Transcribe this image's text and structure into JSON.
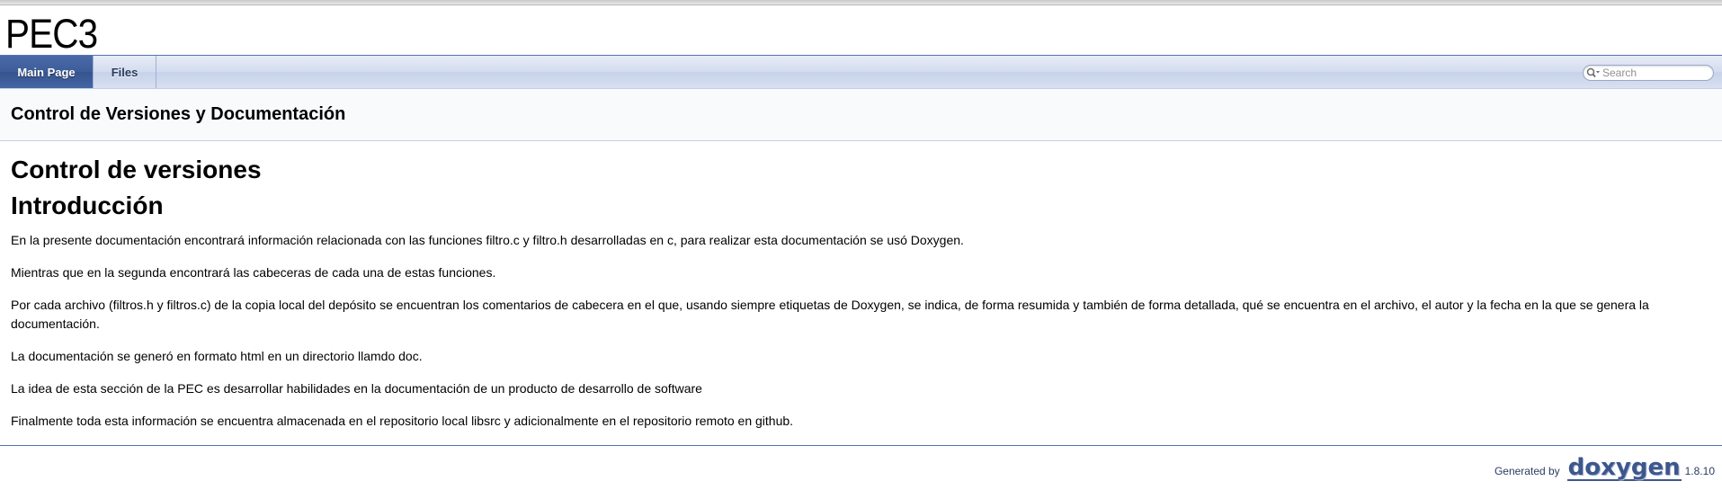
{
  "project": {
    "name": "PEC3"
  },
  "nav": {
    "tabs": [
      {
        "label": "Main Page",
        "active": true
      },
      {
        "label": "Files",
        "active": false
      }
    ],
    "search": {
      "placeholder": "Search",
      "value": ""
    }
  },
  "header": {
    "title": "Control de Versiones y Documentación"
  },
  "content": {
    "headings": [
      "Control de versiones",
      "Introducción"
    ],
    "paragraphs": [
      "En la presente documentación encontrará información relacionada con las funciones filtro.c y filtro.h desarrolladas en c, para realizar esta documentación se usó Doxygen.",
      "Mientras que en la segunda encontrará las cabeceras de cada una de estas funciones.",
      "Por cada archivo (filtros.h y filtros.c) de la copia local del depósito se encuentran los comentarios de cabecera en el que, usando siempre etiquetas de Doxygen, se indica, de forma resumida y también de forma detallada, qué se encuentra en el archivo, el autor y la fecha en la que se genera la documentación.",
      "La documentación se generó en formato html en un directorio llamdo doc.",
      "La idea de esta sección de la PEC es desarrollar habilidades en la documentación de un producto de desarrollo de software",
      "Finalmente toda esta información se encuentra almacenada en el repositorio local libsrc y adicionalmente en el repositorio remoto en github."
    ]
  },
  "footer": {
    "generated_by": "Generated by",
    "logo_text": "doxygen",
    "version": "1.8.10"
  },
  "colors": {
    "active_tab": "#3d5c99",
    "nav_text": "#283a5d",
    "rule": "#5373b4",
    "logo": "#3d578c"
  }
}
